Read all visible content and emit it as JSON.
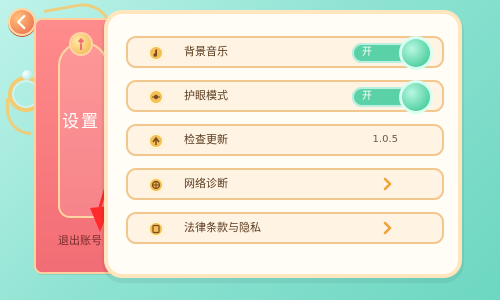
{
  "nav": {
    "back_icon": "back-arrow-icon"
  },
  "side_panel": {
    "title": "设置",
    "logout_label": "退出账号"
  },
  "settings": {
    "rows": [
      {
        "label": "背景音乐",
        "icon": "music-note-icon",
        "toggle_label": "开",
        "toggle_on": true
      },
      {
        "label": "护眼模式",
        "icon": "eye-care-icon",
        "toggle_label": "开",
        "toggle_on": true
      },
      {
        "label": "检查更新",
        "icon": "update-icon",
        "value": "1.0.5"
      },
      {
        "label": "网络诊断",
        "icon": "globe-icon"
      },
      {
        "label": "法律条款与隐私",
        "icon": "document-icon"
      }
    ]
  },
  "colors": {
    "accent_red": "#f26d75",
    "toggle_green": "#5bd1a7",
    "row_bg": "#fff3e4",
    "row_border": "#f2c78e"
  }
}
